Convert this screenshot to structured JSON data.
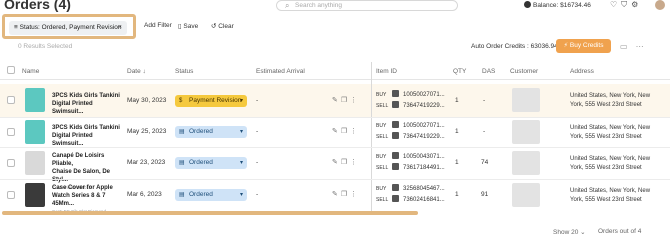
{
  "header": {
    "title": "Orders (4)",
    "search_placeholder": "Search anything",
    "balance_label": "Balance: $16734.46"
  },
  "filters": {
    "chip_label": "Status: Ordered, Payment Revision",
    "chip_close": "×",
    "add_filter": "Add Filter",
    "save": "Save",
    "clear": "Clear"
  },
  "toolbar": {
    "results_selected": "0 Results Selected",
    "auto_credits": "Auto Order Credits : 63036.94",
    "buy_credits": "Buy Credits"
  },
  "columns": {
    "name": "Name",
    "date": "Date",
    "status": "Status",
    "estimated_arrival": "Estimated Arrival",
    "item_id": "Item ID",
    "qty": "QTY",
    "das": "DAS",
    "customer": "Customer",
    "address": "Address"
  },
  "rows": [
    {
      "name_line1": "3PCS Kids Girls Tankini",
      "name_line2": "Digital Printed Swimsuit...",
      "date": "May 30, 2023",
      "status": "Payment Revision",
      "arrival": "-",
      "buy_label": "BUY",
      "sell_label": "SELL",
      "buy_id": "10050027071...",
      "sell_id": "73647419229...",
      "qty": "1",
      "das": "-",
      "addr1": "United States, New York, New",
      "addr2": "York, 555 West 23rd Street"
    },
    {
      "name_line1": "3PCS Kids Girls Tankini",
      "name_line2": "Digital Printed Swimsuit...",
      "date": "May 25, 2023",
      "status": "Ordered",
      "arrival": "-",
      "buy_label": "BUY",
      "sell_label": "SELL",
      "buy_id": "10050027071...",
      "sell_id": "73647419229...",
      "qty": "1",
      "das": "-",
      "addr1": "United States, New York, New",
      "addr2": "York, 555 West 23rd Street"
    },
    {
      "name_line1": "Canapé De Loisirs Pliable,",
      "name_line2": "Chaise De Salon, De Styl...",
      "name_sub": "Cost: Vinda 609018",
      "date": "Mar 23, 2023",
      "status": "Ordered",
      "arrival": "-",
      "buy_label": "BUY",
      "sell_label": "SELL",
      "buy_id": "10050043071...",
      "sell_id": "73617184491...",
      "qty": "1",
      "das": "74",
      "addr1": "United States, New York, New",
      "addr2": "York, 555 West 23rd Street"
    },
    {
      "name_line1": "Case Cover for Apple",
      "name_line2": "Watch Series 8 & 7 45Mm...",
      "name_sub": "Cost: FC Cib Slot Diamond...",
      "date": "Mar 6, 2023",
      "status": "Ordered",
      "arrival": "-",
      "buy_label": "BUY",
      "sell_label": "SELL",
      "buy_id": "32568045467...",
      "sell_id": "73602416841...",
      "qty": "1",
      "das": "91",
      "addr1": "United States, New York, New",
      "addr2": "York, 555 West 23rd Street"
    }
  ],
  "footer": {
    "show_label": "Show",
    "show_value": "20",
    "orders_out_of": "Orders out of 4"
  },
  "colors": {
    "accent": "#f0a24e",
    "highlight_border": "#e2b77e",
    "ordered_bg": "#cfe3f7",
    "payment_bg": "#f5c93e"
  }
}
